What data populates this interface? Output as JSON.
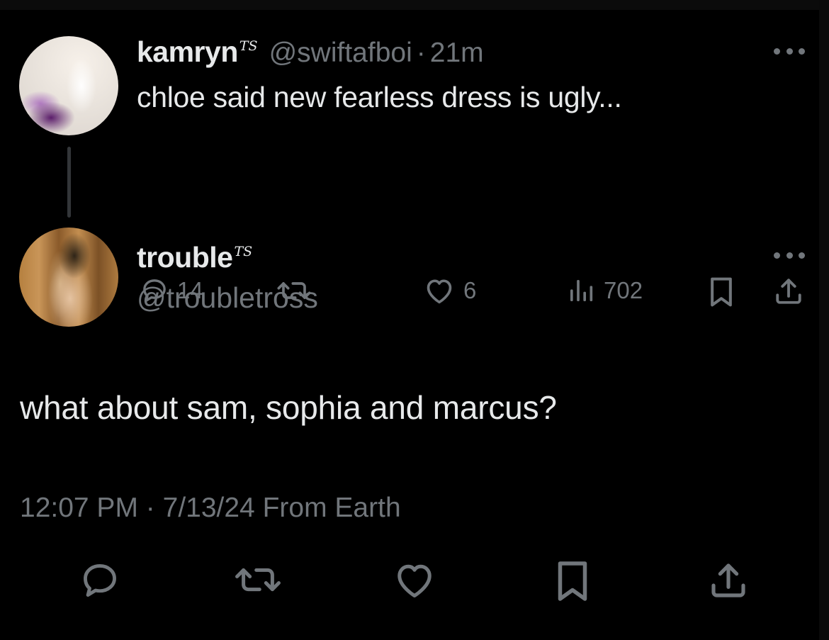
{
  "parent_tweet": {
    "author_name": "kamryn",
    "author_badge": "TS",
    "author_handle": "@swiftafboi",
    "separator": "·",
    "time_ago": "21m",
    "text": "chloe said new fearless dress is ugly...",
    "reply_count": "14",
    "retweet_count": "",
    "like_count": "6",
    "view_count": "702",
    "avatar_icon": "profile-photo-icon"
  },
  "reply_tweet": {
    "author_name": "trouble",
    "author_badge": "TS",
    "author_handle": "@troubletross",
    "text": "what about sam, sophia and marcus?",
    "time": "12:07 PM",
    "separator": "·",
    "date": "7/13/24",
    "source": "From Earth",
    "avatar_icon": "profile-photo-icon"
  },
  "icons": {
    "reply": "reply-icon",
    "retweet": "retweet-icon",
    "like": "like-icon",
    "views": "views-icon",
    "bookmark": "bookmark-icon",
    "share": "share-icon",
    "more": "more-icon"
  },
  "colors": {
    "background": "#000000",
    "text_primary": "#e7e9ea",
    "text_secondary": "#71767b",
    "thread_line": "#333639"
  }
}
